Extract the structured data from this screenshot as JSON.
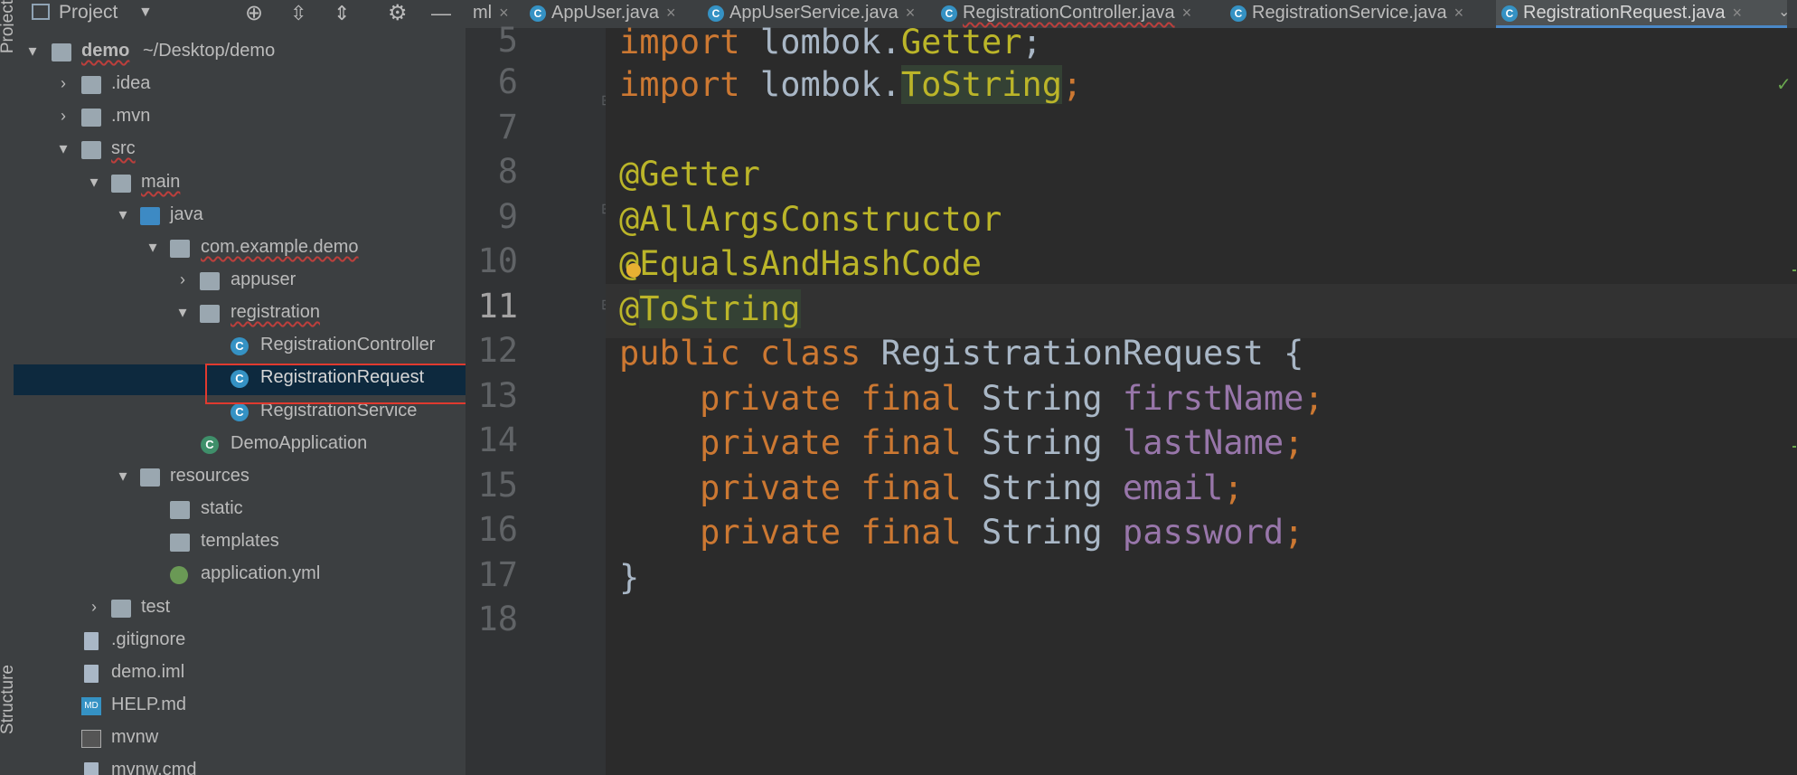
{
  "left_strip": {
    "project_label": "Project",
    "structure_label": "Structure"
  },
  "project_panel": {
    "title": "Project",
    "dropdown_icon": "chevron-down-icon",
    "actions": [
      "locate-icon",
      "expand-all-icon",
      "collapse-all-icon",
      "gear-icon",
      "minimize-icon"
    ]
  },
  "tree": [
    {
      "label": "demo",
      "suffix": "~/Desktop/demo",
      "arrow": "▾",
      "icon": "module-folder"
    },
    {
      "label": ".idea",
      "arrow": "›",
      "icon": "folder"
    },
    {
      "label": ".mvn",
      "arrow": "›",
      "icon": "folder"
    },
    {
      "label": "src",
      "arrow": "▾",
      "icon": "folder"
    },
    {
      "label": "main",
      "arrow": "▾",
      "icon": "folder"
    },
    {
      "label": "java",
      "arrow": "▾",
      "icon": "source-folder"
    },
    {
      "label": "com.example.demo",
      "arrow": "▾",
      "icon": "package"
    },
    {
      "label": "appuser",
      "arrow": "›",
      "icon": "package"
    },
    {
      "label": "registration",
      "arrow": "▾",
      "icon": "package"
    },
    {
      "label": "RegistrationController",
      "arrow": "",
      "icon": "class"
    },
    {
      "label": "RegistrationRequest",
      "arrow": "",
      "icon": "class"
    },
    {
      "label": "RegistrationService",
      "arrow": "",
      "icon": "class"
    },
    {
      "label": "DemoApplication",
      "arrow": "",
      "icon": "spring-class"
    },
    {
      "label": "resources",
      "arrow": "▾",
      "icon": "resources-folder"
    },
    {
      "label": "static",
      "arrow": "",
      "icon": "folder"
    },
    {
      "label": "templates",
      "arrow": "",
      "icon": "folder"
    },
    {
      "label": "application.yml",
      "arrow": "",
      "icon": "spring-config"
    },
    {
      "label": "test",
      "arrow": "›",
      "icon": "folder"
    },
    {
      "label": ".gitignore",
      "arrow": "",
      "icon": "file"
    },
    {
      "label": "demo.iml",
      "arrow": "",
      "icon": "file"
    },
    {
      "label": "HELP.md",
      "arrow": "",
      "icon": "markdown"
    },
    {
      "label": "mvnw",
      "arrow": "",
      "icon": "file"
    },
    {
      "label": "mvnw.cmd",
      "arrow": "",
      "icon": "file"
    }
  ],
  "tabs": [
    {
      "label": "ml"
    },
    {
      "label": "AppUser.java"
    },
    {
      "label": "AppUserService.java"
    },
    {
      "label": "RegistrationController.java"
    },
    {
      "label": "RegistrationService.java"
    },
    {
      "label": "RegistrationRequest.java",
      "active": true
    }
  ],
  "editor": {
    "current_line": "11",
    "lines": [
      {
        "num": "5",
        "text": "import lombok.Getter;"
      },
      {
        "num": "6",
        "text": "import lombok.ToString;"
      },
      {
        "num": "7",
        "text": ""
      },
      {
        "num": "8",
        "text": "@Getter"
      },
      {
        "num": "9",
        "text": "@AllArgsConstructor"
      },
      {
        "num": "10",
        "text": "@EqualsAndHashCode"
      },
      {
        "num": "11",
        "text": "@ToString"
      },
      {
        "num": "12",
        "text": "public class RegistrationRequest {"
      },
      {
        "num": "13",
        "text": "    private final String firstName;"
      },
      {
        "num": "14",
        "text": "    private final String lastName;"
      },
      {
        "num": "15",
        "text": "    private final String email;"
      },
      {
        "num": "16",
        "text": "    private final String password;"
      },
      {
        "num": "17",
        "text": "}"
      },
      {
        "num": "18",
        "text": ""
      }
    ]
  },
  "colors": {
    "keyword": "#cc7832",
    "annotation": "#bbb529",
    "field": "#9876aa",
    "selection": "#0d293e",
    "highlight_box": "#e03a2f"
  }
}
